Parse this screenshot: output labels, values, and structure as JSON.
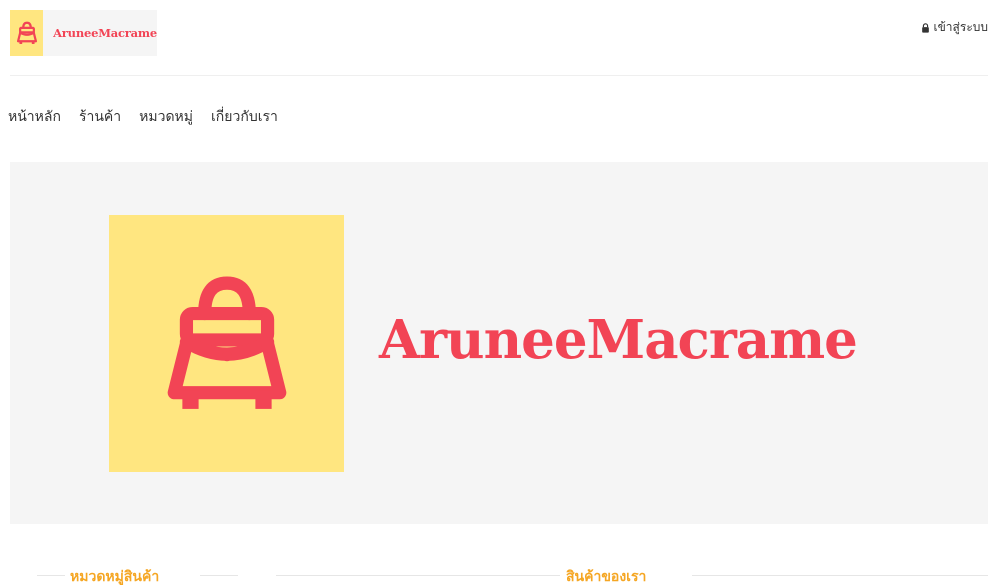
{
  "header": {
    "brand": "AruneeMacrame",
    "login_label": "เข้าสู่ระบบ"
  },
  "nav": {
    "items": [
      "หน้าหลัก",
      "ร้านค้า",
      "หมวดหมู่",
      "เกี่ยวกับเรา"
    ]
  },
  "hero": {
    "brand": "AruneeMacrame"
  },
  "sections": {
    "categories_title": "หมวดหมู่สินค้า",
    "products_title": "สินค้าของเรา"
  },
  "colors": {
    "brand_red": "#f24455",
    "logo_yellow": "#ffe680",
    "section_orange": "#f5a623"
  },
  "icons": {
    "logo": "bag-icon",
    "login": "lock-icon"
  }
}
